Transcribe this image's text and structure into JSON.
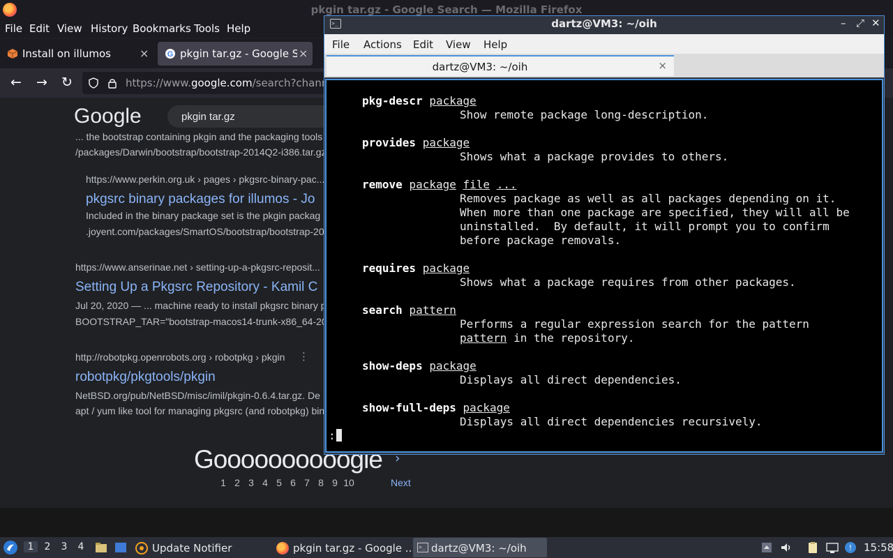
{
  "firefox": {
    "window_title": "pkgin tar.gz - Google Search — Mozilla Firefox",
    "menu": [
      "File",
      "Edit",
      "View",
      "History",
      "Bookmarks",
      "Tools",
      "Help"
    ],
    "tabs": [
      {
        "label": "Install on illumos",
        "icon": "package-icon"
      },
      {
        "label": "pkgin tar.gz - Google Sea",
        "icon": "google-icon"
      }
    ],
    "url_prefix": "https://www.",
    "url_domain": "google.com",
    "url_rest": "/search?channel",
    "close_glyph": "×"
  },
  "google": {
    "logo": "Google",
    "query": "pkgin tar.gz",
    "results": [
      {
        "snippet1": "... the bootstrap containing pkgin and the packaging tools",
        "snippet2": "/packages/Darwin/bootstrap/bootstrap-2014Q2-i386.tar.gz"
      },
      {
        "cite": "https://www.perkin.org.uk › pages › pkgsrc-binary-pac...",
        "title": "pkgsrc binary packages for illumos - Jo",
        "snippet1": "Included in the binary package set is the pkgin packag",
        "snippet2": ".joyent.com/packages/SmartOS/bootstrap/bootstrap-20"
      },
      {
        "cite": "https://www.anserinae.net › setting-up-a-pkgsrc-reposit...",
        "title": "Setting Up a Pkgsrc Repository - Kamil C",
        "snippet1": "Jul 20, 2020 — ... machine ready to install pkgsrc binary p",
        "snippet2": "BOOTSTRAP_TAR=\"bootstrap-macos14-trunk-x86_64-20"
      },
      {
        "cite": "http://robotpkg.openrobots.org › robotpkg › pkgin",
        "title": "robotpkg/pkgtools/pkgin",
        "snippet1": "NetBSD.org/pub/NetBSD/misc/imil/pkgin-0.6.4.tar.gz. De",
        "snippet2": "apt / yum like tool for managing pkgsrc (and robotpkg) bin"
      }
    ],
    "more_dots": "⋮",
    "pager_logo": "Goooooooooogle",
    "pager_arrow": "›",
    "pages": [
      "1",
      "2",
      "3",
      "4",
      "5",
      "6",
      "7",
      "8",
      "9",
      "10"
    ],
    "next": "Next"
  },
  "terminal": {
    "title": "dartz@VM3: ~/oih",
    "menu": [
      "File",
      "Actions",
      "Edit",
      "View",
      "Help"
    ],
    "tab_label": "dartz@VM3: ~/oih",
    "close_glyph": "×",
    "prompt": ":",
    "entries": [
      {
        "cmd": "pkg-descr",
        "args": [
          "package"
        ],
        "desc": [
          "Show remote package long-description."
        ]
      },
      {
        "cmd": "provides",
        "args": [
          "package"
        ],
        "desc": [
          "Shows what a package provides to others."
        ]
      },
      {
        "cmd": "remove",
        "args": [
          "package",
          "file",
          "..."
        ],
        "desc": [
          "Removes package as well as all packages depending on it.",
          "When more than one package are specified, they will all be",
          "uninstalled.  By default, it will prompt you to confirm",
          "before package removals."
        ]
      },
      {
        "cmd": "requires",
        "args": [
          "package"
        ],
        "desc": [
          "Shows what a package requires from other packages."
        ]
      },
      {
        "cmd": "search",
        "args": [
          "pattern"
        ],
        "desc_first_underlined": "pattern",
        "desc": [
          "Performs a regular expression search for the pattern",
          "in the repository."
        ]
      },
      {
        "cmd": "show-deps",
        "args": [
          "package"
        ],
        "desc": [
          "Displays all direct dependencies."
        ]
      },
      {
        "cmd": "show-full-deps",
        "args": [
          "package"
        ],
        "desc": [
          "Displays all direct dependencies recursively."
        ]
      }
    ]
  },
  "taskbar": {
    "workspaces": [
      "1",
      "2",
      "3",
      "4"
    ],
    "windows": [
      {
        "label": "Update Notifier",
        "icon": "update-notifier-icon"
      },
      {
        "label": "pkgin tar.gz - Google ...",
        "icon": "firefox-icon"
      },
      {
        "label": "dartz@VM3: ~/oih",
        "icon": "terminal-icon"
      }
    ],
    "clock": "15:58"
  }
}
